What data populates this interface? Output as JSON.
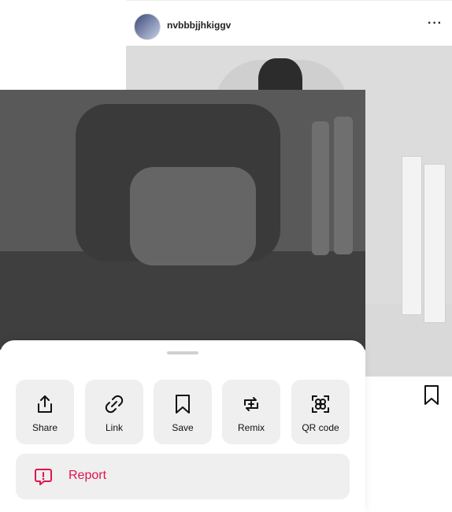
{
  "post": {
    "username": "nvbbbjjhkiggv",
    "more_label": "···"
  },
  "sheet": {
    "actions": [
      {
        "label": "Share",
        "icon": "share-icon"
      },
      {
        "label": "Link",
        "icon": "link-icon"
      },
      {
        "label": "Save",
        "icon": "bookmark-icon"
      },
      {
        "label": "Remix",
        "icon": "remix-icon"
      },
      {
        "label": "QR code",
        "icon": "qr-code-icon"
      }
    ],
    "report": {
      "label": "Report",
      "icon": "report-icon",
      "color": "#e0144c"
    }
  },
  "colors": {
    "sheet_bg": "#ffffff",
    "tile_bg": "#efefef",
    "overlay": "#4a4a4a"
  }
}
